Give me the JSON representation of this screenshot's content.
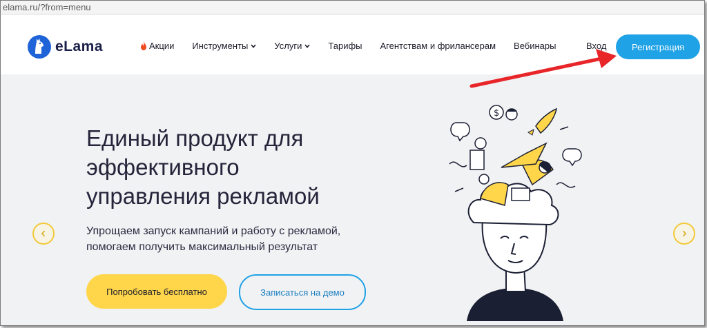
{
  "browser": {
    "url": "elama.ru/?from=menu"
  },
  "header": {
    "logo_text": "eLama",
    "nav": [
      {
        "label": "Акции",
        "icon": "fire-icon"
      },
      {
        "label": "Инструменты",
        "icon": "chevron-down-icon"
      },
      {
        "label": "Услуги",
        "icon": "chevron-down-icon"
      },
      {
        "label": "Тарифы"
      },
      {
        "label": "Агентствам и фрилансерам"
      },
      {
        "label": "Вебинары"
      }
    ],
    "login_label": "Вход",
    "register_label": "Регистрация"
  },
  "hero": {
    "title_lines": [
      "Единый продукт для",
      "эффективного",
      "управления рекламой"
    ],
    "subtitle_lines": [
      "Упрощаем запуск кампаний и работу с рекламой,",
      "помогаем получить максимальный результат"
    ],
    "try_label": "Попробовать бесплатно",
    "demo_label": "Записаться на демо"
  },
  "colors": {
    "accent_blue": "#1fa2e6",
    "accent_yellow": "#ffd54a",
    "hero_bg": "#f1f2f4",
    "annotation_red": "#e8262a"
  }
}
